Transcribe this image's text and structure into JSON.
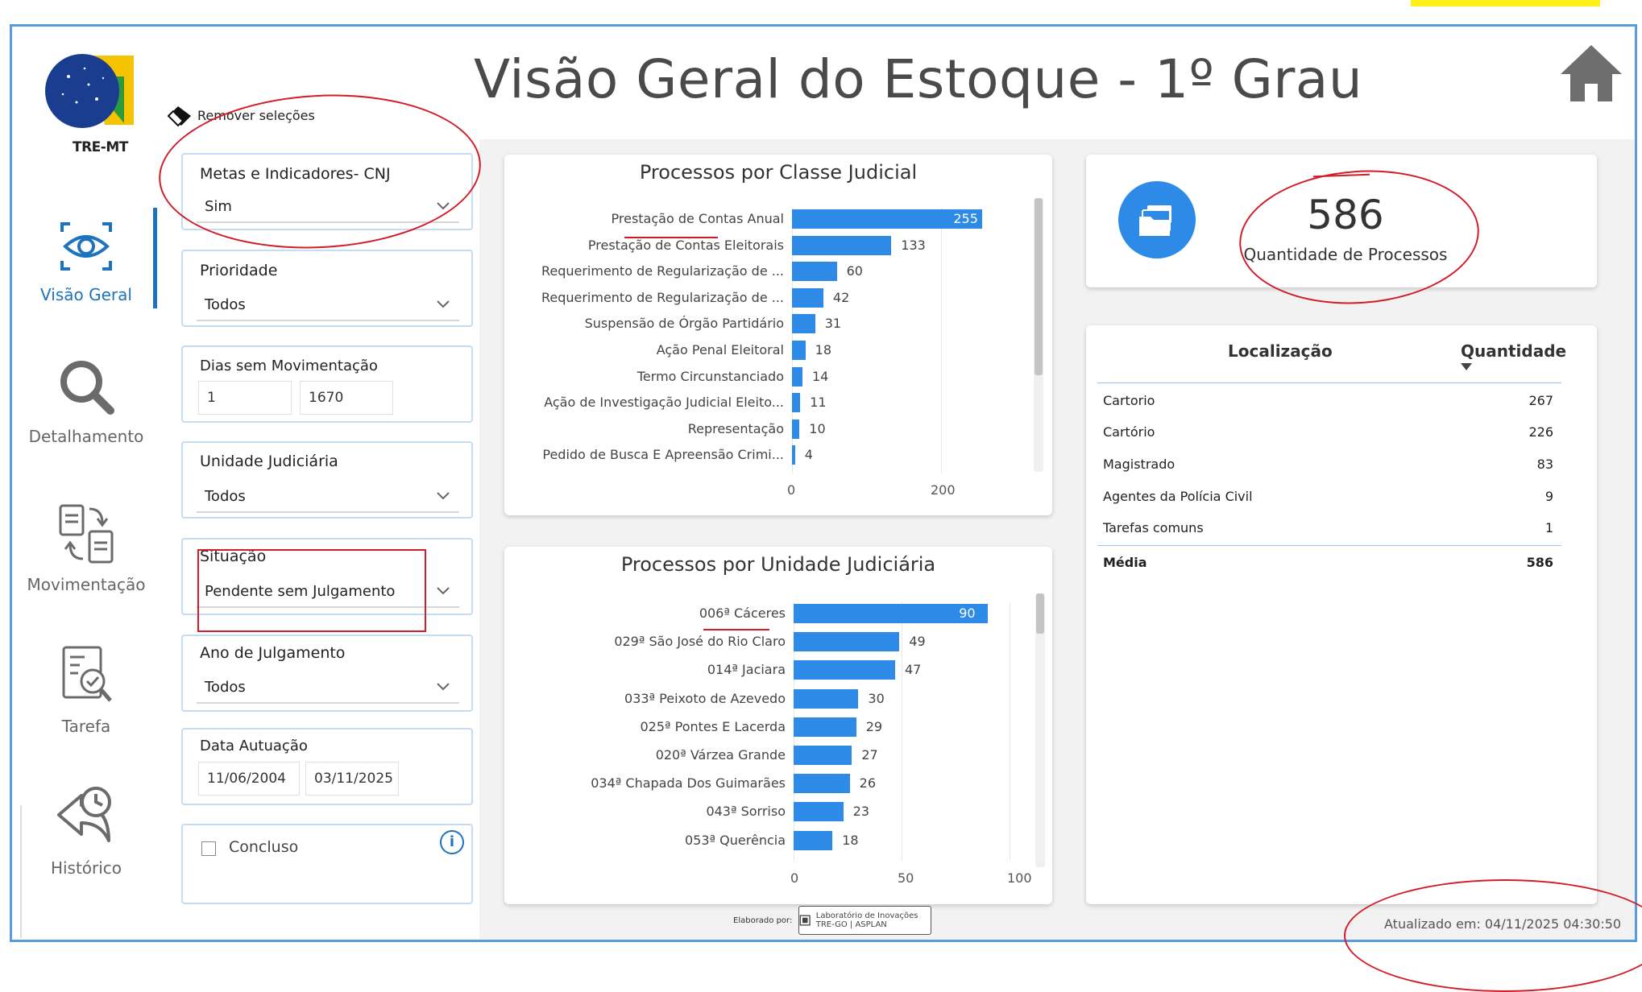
{
  "header": {
    "title": "Visão Geral do Estoque - 1º Grau",
    "logo_text": "TRE-MT",
    "remove_selections": "Remover seleções"
  },
  "nav": [
    {
      "label": "Visão Geral",
      "icon": "eye-icon",
      "active": true
    },
    {
      "label": "Detalhamento",
      "icon": "magnifier-icon",
      "active": false
    },
    {
      "label": "Movimentação",
      "icon": "documents-exchange-icon",
      "active": false
    },
    {
      "label": "Tarefa",
      "icon": "task-check-icon",
      "active": false
    },
    {
      "label": "Histórico",
      "icon": "history-clock-icon",
      "active": false
    }
  ],
  "filters": {
    "metas": {
      "title": "Metas e Indicadores- CNJ",
      "value": "Sim"
    },
    "prioridade": {
      "title": "Prioridade",
      "value": "Todos"
    },
    "dias": {
      "title": "Dias sem Movimentação",
      "min": "1",
      "max": "1670"
    },
    "unidade": {
      "title": "Unidade Judiciária",
      "value": "Todos"
    },
    "situacao": {
      "title": "Situação",
      "value": "Pendente sem Julgamento"
    },
    "ano": {
      "title": "Ano de Julgamento",
      "value": "Todos"
    },
    "data": {
      "title": "Data Autuação",
      "start": "11/06/2004",
      "end": "03/11/2025"
    },
    "concluso": {
      "label": "Concluso",
      "checked": false
    }
  },
  "chart_classe": {
    "title": "Processos por Classe Judicial",
    "ticks": [
      "0",
      "200"
    ]
  },
  "chart_unidade": {
    "title": "Processos por Unidade Judiciária",
    "ticks": [
      "0",
      "50",
      "100"
    ]
  },
  "chart_data": [
    {
      "type": "bar",
      "orientation": "horizontal",
      "title": "Processos por Classe Judicial",
      "categories": [
        "Prestação de Contas Anual",
        "Prestação de Contas Eleitorais",
        "Requerimento de Regularização de ...",
        "Requerimento de Regularização de ...",
        "Suspensão de Órgão Partidário",
        "Ação Penal Eleitoral",
        "Termo Circunstanciado",
        "Ação de Investigação Judicial Eleito...",
        "Representação",
        "Pedido de Busca E Apreensão Crimi..."
      ],
      "values": [
        255,
        133,
        60,
        42,
        31,
        18,
        14,
        11,
        10,
        4
      ],
      "xlim": [
        0,
        260
      ],
      "xticks": [
        0,
        200
      ],
      "color": "#2d8ae6"
    },
    {
      "type": "bar",
      "orientation": "horizontal",
      "title": "Processos por Unidade Judiciária",
      "categories": [
        "006ª Cáceres",
        "029ª São José do Rio Claro",
        "014ª Jaciara",
        "033ª Peixoto de Azevedo",
        "025ª Pontes E Lacerda",
        "020ª Várzea Grande",
        "034ª Chapada Dos Guimarães",
        "043ª Sorriso",
        "053ª Querência"
      ],
      "values": [
        90,
        49,
        47,
        30,
        29,
        27,
        26,
        23,
        18
      ],
      "xlim": [
        0,
        100
      ],
      "xticks": [
        0,
        50,
        100
      ],
      "color": "#2d8ae6"
    }
  ],
  "kpi": {
    "value": "586",
    "label": "Quantidade de Processos",
    "icon": "folders-icon"
  },
  "table": {
    "col1": "Localização",
    "col2": "Quantidade",
    "rows": [
      {
        "name": "Cartorio",
        "value": "267"
      },
      {
        "name": "Cartório",
        "value": "226"
      },
      {
        "name": "Magistrado",
        "value": "83"
      },
      {
        "name": "Agentes da Polícia Civil",
        "value": "9"
      },
      {
        "name": "Tarefas comuns",
        "value": "1"
      }
    ],
    "total_label": "Média",
    "total_value": "586"
  },
  "footer": {
    "credit_label": "Elaborado por:",
    "credit_box": "Laboratório de Inovações TRE-GO | ASPLAN",
    "updated": "Atualizado em: 04/11/2025 04:30:50"
  },
  "colors": {
    "accent": "#1e73be",
    "bar": "#2d8ae6",
    "annotation": "#d11c2a",
    "frame": "#5a9be0"
  }
}
